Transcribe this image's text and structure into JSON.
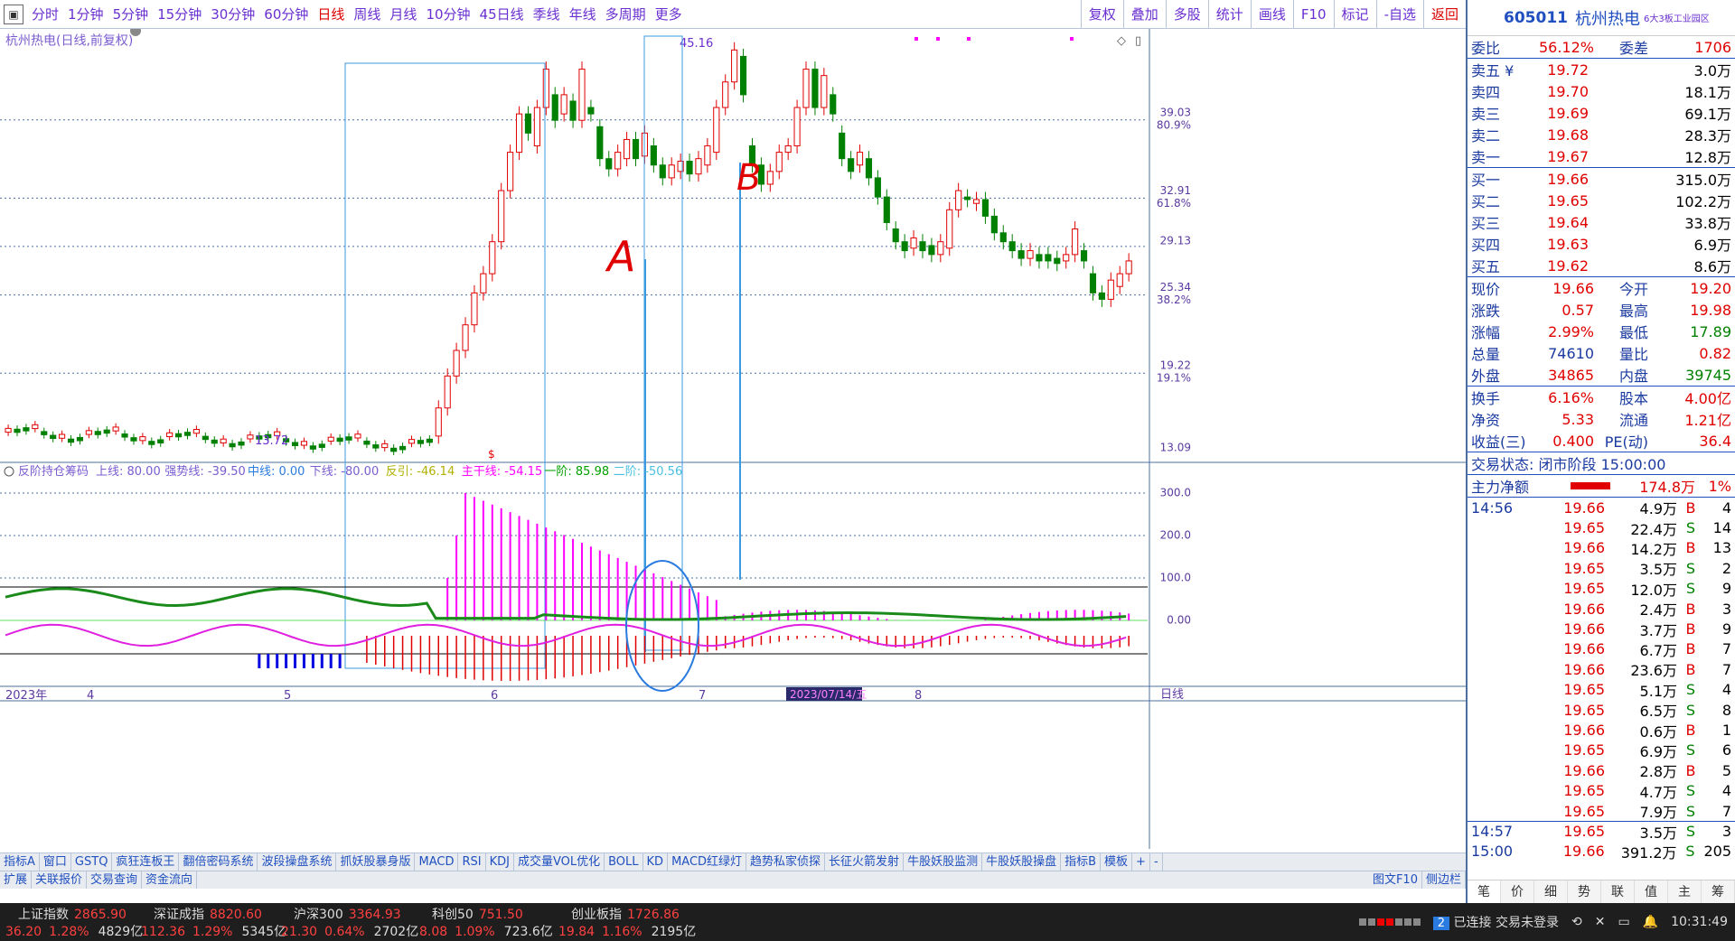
{
  "topbar": {
    "periods": [
      "分时",
      "1分钟",
      "5分钟",
      "15分钟",
      "30分钟",
      "60分钟",
      "日线",
      "周线",
      "月线",
      "10分钟",
      "45日线",
      "季线",
      "年线",
      "多周期",
      "更多"
    ],
    "active_period": "日线",
    "right_tools": [
      "复权",
      "叠加",
      "多股",
      "统计",
      "画线",
      "F10",
      "标记",
      "-自选",
      "返回"
    ]
  },
  "chart": {
    "title": "杭州热电(日线,前复权)",
    "price_labels": [
      "39.03",
      "80.9%",
      "32.91",
      "61.8%",
      "29.13",
      "25.34",
      "38.2%",
      "19.22",
      "19.1%",
      "13.09"
    ],
    "high_marker": "45.16",
    "low_marker": "13.72",
    "annotation_a": "A",
    "annotation_b": "B",
    "indicator_header": {
      "name": "反阶持仓筹码",
      "items": [
        "上线: 80.00",
        "强势线: -39.50",
        "中线: 0.00",
        "下线: -80.00",
        "反引: -46.14",
        "主干线: -54.15",
        "一阶: 85.98",
        "二阶: -50.56"
      ]
    },
    "indicator_labels": [
      "300.0",
      "200.0",
      "100.0",
      "0.00"
    ],
    "x_labels": [
      "2023年",
      "4",
      "5",
      "6",
      "7",
      "8"
    ],
    "date_box": "2023/07/14/五",
    "period_label": "日线"
  },
  "indicator_tabs": [
    "指标A",
    "窗口",
    "GSTQ",
    "疯狂连板王",
    "翻倍密码系统",
    "波段操盘系统",
    "抓妖股暴身版",
    "MACD",
    "RSI",
    "KDJ",
    "成交量VOL优化",
    "BOLL",
    "KD",
    "MACD红绿灯",
    "趋势私家侦探",
    "长征火箭发射",
    "牛股妖股监测",
    "牛股妖股操盘",
    "指标B",
    "模板",
    "+",
    "-"
  ],
  "bottom_tabs": [
    "扩展",
    "关联报价",
    "交易查询",
    "资金流向"
  ],
  "side": {
    "code": "605011",
    "name": "杭州热电",
    "sub": "6大3板工业园区",
    "weibi": {
      "label": "委比",
      "value": "56.12%",
      "label2": "委差",
      "value2": "1706"
    },
    "sell": [
      {
        "label": "卖五 ¥",
        "price": "19.72",
        "vol": "3.0万"
      },
      {
        "label": "卖四",
        "price": "19.70",
        "vol": "18.1万"
      },
      {
        "label": "卖三",
        "price": "19.69",
        "vol": "69.1万"
      },
      {
        "label": "卖二",
        "price": "19.68",
        "vol": "28.3万"
      },
      {
        "label": "卖一",
        "price": "19.67",
        "vol": "12.8万"
      }
    ],
    "buy": [
      {
        "label": "买一",
        "price": "19.66",
        "vol": "315.0万"
      },
      {
        "label": "买二",
        "price": "19.65",
        "vol": "102.2万"
      },
      {
        "label": "买三",
        "price": "19.64",
        "vol": "33.8万"
      },
      {
        "label": "买四",
        "price": "19.63",
        "vol": "6.9万"
      },
      {
        "label": "买五",
        "price": "19.62",
        "vol": "8.6万"
      }
    ],
    "quote": [
      {
        "l1": "现价",
        "v1": "19.66",
        "l2": "今开",
        "v2": "19.20"
      },
      {
        "l1": "涨跌",
        "v1": "0.57",
        "l2": "最高",
        "v2": "19.98"
      },
      {
        "l1": "涨幅",
        "v1": "2.99%",
        "l2": "最低",
        "v2": "17.89"
      },
      {
        "l1": "总量",
        "v1": "74610",
        "l2": "量比",
        "v2": "0.82"
      },
      {
        "l1": "外盘",
        "v1": "34865",
        "l2": "内盘",
        "v2": "39745"
      }
    ],
    "stats": [
      {
        "l1": "换手",
        "v1": "6.16%",
        "l2": "股本",
        "v2": "4.00亿"
      },
      {
        "l1": "净资",
        "v1": "5.33",
        "l2": "流通",
        "v2": "1.21亿"
      },
      {
        "l1": "收益(三)",
        "v1": "0.400",
        "l2": "PE(动)",
        "v2": "36.4"
      }
    ],
    "trade_status": "交易状态: 闭市阶段 15:00:00",
    "main_net": {
      "label": "主力净额",
      "value": "174.8万",
      "pct": "1%"
    },
    "ticks": [
      {
        "t": "14:56",
        "p": "19.66",
        "v": "4.9万",
        "bs": "B",
        "n": "4"
      },
      {
        "t": "",
        "p": "19.65",
        "v": "22.4万",
        "bs": "S",
        "n": "14"
      },
      {
        "t": "",
        "p": "19.66",
        "v": "14.2万",
        "bs": "B",
        "n": "13"
      },
      {
        "t": "",
        "p": "19.65",
        "v": "3.5万",
        "bs": "S",
        "n": "2"
      },
      {
        "t": "",
        "p": "19.65",
        "v": "12.0万",
        "bs": "S",
        "n": "9"
      },
      {
        "t": "",
        "p": "19.66",
        "v": "2.4万",
        "bs": "B",
        "n": "3"
      },
      {
        "t": "",
        "p": "19.66",
        "v": "3.7万",
        "bs": "B",
        "n": "9"
      },
      {
        "t": "",
        "p": "19.66",
        "v": "6.7万",
        "bs": "B",
        "n": "7"
      },
      {
        "t": "",
        "p": "19.66",
        "v": "23.6万",
        "bs": "B",
        "n": "7"
      },
      {
        "t": "",
        "p": "19.65",
        "v": "5.1万",
        "bs": "S",
        "n": "4"
      },
      {
        "t": "",
        "p": "19.65",
        "v": "6.5万",
        "bs": "S",
        "n": "8"
      },
      {
        "t": "",
        "p": "19.66",
        "v": "0.6万",
        "bs": "B",
        "n": "1"
      },
      {
        "t": "",
        "p": "19.65",
        "v": "6.9万",
        "bs": "S",
        "n": "6"
      },
      {
        "t": "",
        "p": "19.66",
        "v": "2.8万",
        "bs": "B",
        "n": "5"
      },
      {
        "t": "",
        "p": "19.65",
        "v": "4.7万",
        "bs": "S",
        "n": "4"
      },
      {
        "t": "",
        "p": "19.65",
        "v": "7.9万",
        "bs": "S",
        "n": "7"
      },
      {
        "t": "14:57",
        "p": "19.65",
        "v": "3.5万",
        "bs": "S",
        "n": "3"
      },
      {
        "t": "15:00",
        "p": "19.66",
        "v": "391.2万",
        "bs": "S",
        "n": "205"
      }
    ],
    "tabs": [
      "笔",
      "价",
      "细",
      "势",
      "联",
      "值",
      "主",
      "筹"
    ]
  },
  "status": {
    "indices": [
      {
        "name": "上证指数",
        "value": "2865.90",
        "chg": "36.20",
        "pct": "1.28%",
        "amt": "4829亿"
      },
      {
        "name": "深证成指",
        "value": "8820.60",
        "chg": "112.36",
        "pct": "1.29%",
        "amt": "5345亿"
      },
      {
        "name": "沪深300",
        "value": "3364.93",
        "chg": "21.30",
        "pct": "0.64%",
        "amt": "2702亿"
      },
      {
        "name": "科创50",
        "value": "751.50",
        "chg": "8.08",
        "pct": "1.09%",
        "amt": "723.6亿"
      },
      {
        "name": "创业板指",
        "value": "1726.86",
        "chg": "19.84",
        "pct": "1.16%",
        "amt": "2195亿"
      }
    ],
    "conn_num": "2",
    "conn_text": "已连接 交易未登录",
    "clock": "10:31:49",
    "right_link": "图文F10",
    "right_link2": "侧边栏"
  },
  "colors": {
    "up": "#e00000",
    "down": "#008000",
    "magenta": "#ff00ff",
    "guide": "#3a9ae0"
  }
}
